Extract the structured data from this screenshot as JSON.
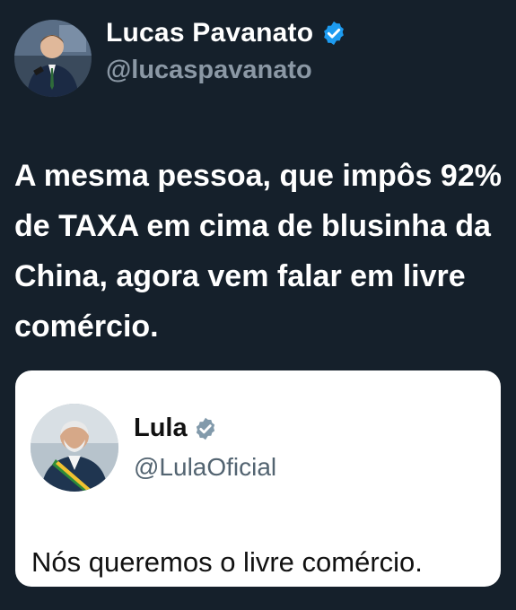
{
  "tweet": {
    "author": {
      "name": "Lucas Pavanato",
      "handle": "@lucaspavanato",
      "verified": true,
      "avatar_icon": "profile-photo"
    },
    "text": "A mesma pessoa, que impôs 92% de TAXA em cima de blusinha da China, agora vem falar em livre comércio."
  },
  "embedded_tweet": {
    "author": {
      "name": "Lula",
      "handle": "@LulaOficial",
      "verified": true,
      "avatar_icon": "profile-photo"
    },
    "text": "Nós queremos o livre comércio."
  },
  "colors": {
    "background": "#15202b",
    "primary_text": "#ffffff",
    "secondary_text": "#8b98a5",
    "verified_blue": "#1d9bf0",
    "embedded_bg": "#ffffff",
    "embedded_text": "#111111",
    "embedded_secondary_text": "#536471",
    "embedded_verified_gray": "#829aab"
  }
}
